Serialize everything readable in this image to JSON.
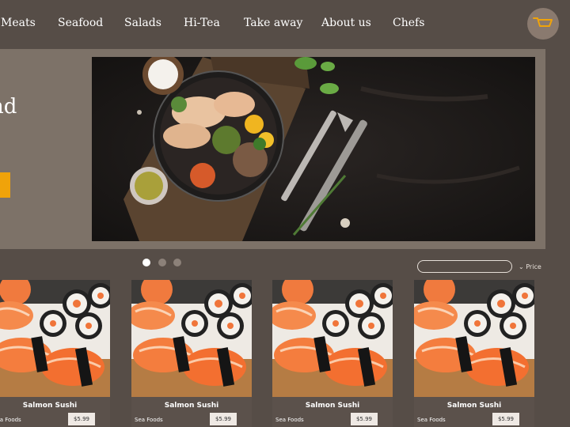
{
  "nav": {
    "items": [
      "Meats",
      "Seafood",
      "Salads",
      "Hi-Tea",
      "Take away",
      "About us",
      "Chefs"
    ],
    "cart_icon": "cart-icon"
  },
  "hero": {
    "title_fragment": "nd"
  },
  "carousel": {
    "dots": 3,
    "active": 0
  },
  "filter": {
    "search_placeholder": "",
    "sort_label": "Price"
  },
  "products": [
    {
      "name": "Salmon Sushi",
      "category": "Sea Foods",
      "price": "$5.99"
    },
    {
      "name": "Salmon Sushi",
      "category": "Sea Foods",
      "price": "$5.99"
    },
    {
      "name": "Salmon Sushi",
      "category": "Sea Foods",
      "price": "$5.99"
    },
    {
      "name": "Salmon Sushi",
      "category": "Sea Foods",
      "price": "$5.99"
    }
  ],
  "colors": {
    "bg": "#564d47",
    "hero": "#7d7268",
    "accent": "#f0a30a",
    "cart_bg": "#8a7a6f"
  }
}
